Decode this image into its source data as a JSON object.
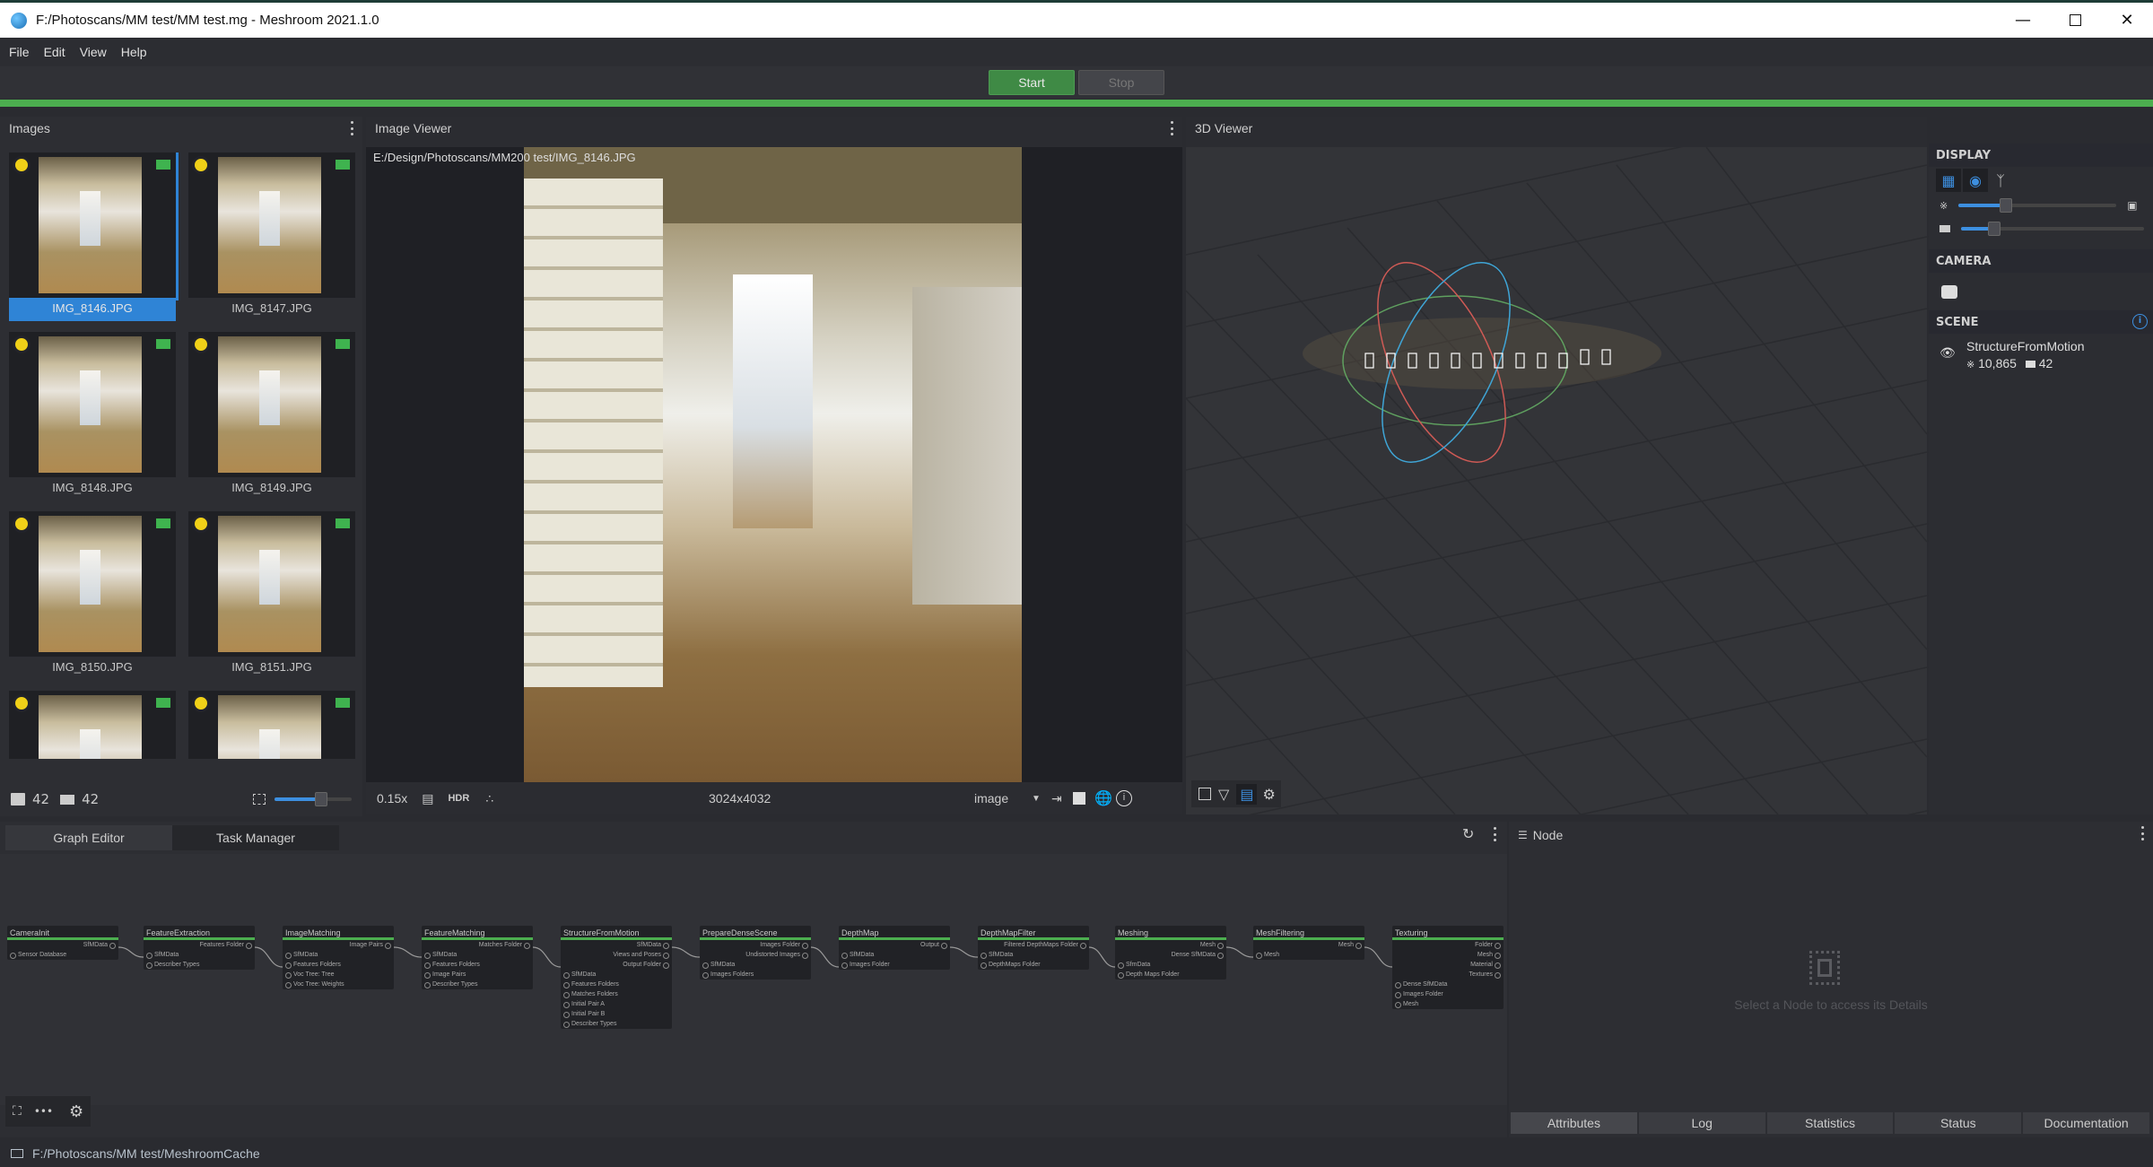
{
  "window": {
    "title": "F:/Photoscans/MM test/MM test.mg - Meshroom 2021.1.0",
    "controls": [
      "minimize",
      "maximize",
      "close"
    ]
  },
  "menu": [
    "File",
    "Edit",
    "View",
    "Help"
  ],
  "toolbar": {
    "start_label": "Start",
    "stop_label": "Stop",
    "progress_percent": 100
  },
  "images_panel": {
    "title": "Images",
    "thumbnails": [
      {
        "name": "IMG_8146.JPG",
        "selected": true
      },
      {
        "name": "IMG_8147.JPG",
        "selected": false
      },
      {
        "name": "IMG_8148.JPG",
        "selected": false
      },
      {
        "name": "IMG_8149.JPG",
        "selected": false
      },
      {
        "name": "IMG_8150.JPG",
        "selected": false
      },
      {
        "name": "IMG_8151.JPG",
        "selected": false
      },
      {
        "name": "",
        "selected": false
      },
      {
        "name": "",
        "selected": false
      }
    ],
    "image_count": "42",
    "camera_count": "42",
    "thumb_size_percent": 60
  },
  "image_viewer": {
    "title": "Image Viewer",
    "path": "E:/Design/Photoscans/MM200 test/IMG_8146.JPG",
    "zoom": "0.15x",
    "hdr_label": "HDR",
    "resolution": "3024x4032",
    "mode": "image"
  },
  "viewer_3d": {
    "title": "3D Viewer",
    "display": {
      "title": "DISPLAY",
      "points_size_percent": 30,
      "camera_scale_percent": 18
    },
    "camera": {
      "title": "CAMERA"
    },
    "scene": {
      "title": "SCENE",
      "item_name": "StructureFromMotion",
      "points": "10,865",
      "cameras": "42"
    }
  },
  "graph_editor": {
    "tabs": [
      "Graph Editor",
      "Task Manager"
    ],
    "active_tab": "Graph Editor",
    "nodes": [
      {
        "name": "CameraInit",
        "outputs": [
          "SfMData"
        ],
        "inputs": [
          "Sensor Database"
        ]
      },
      {
        "name": "FeatureExtraction",
        "outputs": [
          "Features Folder"
        ],
        "inputs": [
          "SfMData",
          "Describer Types"
        ]
      },
      {
        "name": "ImageMatching",
        "outputs": [
          "Image Pairs"
        ],
        "inputs": [
          "SfMData",
          "Features Folders",
          "Voc Tree: Tree",
          "Voc Tree: Weights"
        ]
      },
      {
        "name": "FeatureMatching",
        "outputs": [
          "Matches Folder"
        ],
        "inputs": [
          "SfMData",
          "Features Folders",
          "Image Pairs",
          "Describer Types"
        ]
      },
      {
        "name": "StructureFromMotion",
        "outputs": [
          "SfMData",
          "Views and Poses",
          "Output Folder"
        ],
        "inputs": [
          "SfMData",
          "Features Folders",
          "Matches Folders",
          "Initial Pair A",
          "Initial Pair B",
          "Describer Types"
        ]
      },
      {
        "name": "PrepareDenseScene",
        "outputs": [
          "Images Folder",
          "Undistorted Images"
        ],
        "inputs": [
          "SfMData",
          "Images Folders"
        ]
      },
      {
        "name": "DepthMap",
        "outputs": [
          "Output"
        ],
        "inputs": [
          "SfMData",
          "Images Folder"
        ]
      },
      {
        "name": "DepthMapFilter",
        "outputs": [
          "Filtered DepthMaps Folder"
        ],
        "inputs": [
          "SfMData",
          "DepthMaps Folder"
        ]
      },
      {
        "name": "Meshing",
        "outputs": [
          "Mesh",
          "Dense SfMData"
        ],
        "inputs": [
          "SfmData",
          "Depth Maps Folder"
        ]
      },
      {
        "name": "MeshFiltering",
        "outputs": [
          "Mesh"
        ],
        "inputs": [
          "Mesh"
        ]
      },
      {
        "name": "Texturing",
        "outputs": [
          "Folder",
          "Mesh",
          "Material",
          "Textures"
        ],
        "inputs": [
          "Dense SfMData",
          "Images Folder",
          "Mesh"
        ]
      }
    ]
  },
  "node_panel": {
    "title": "Node",
    "placeholder": "Select a Node to access its Details",
    "tabs": [
      "Attributes",
      "Log",
      "Statistics",
      "Status",
      "Documentation"
    ],
    "active_tab": "Attributes"
  },
  "statusbar": {
    "cache_path": "F:/Photoscans/MM test/MeshroomCache"
  },
  "colors": {
    "accent": "#2f84d6",
    "success": "#4cae4f",
    "start_button": "#3f8a45"
  }
}
